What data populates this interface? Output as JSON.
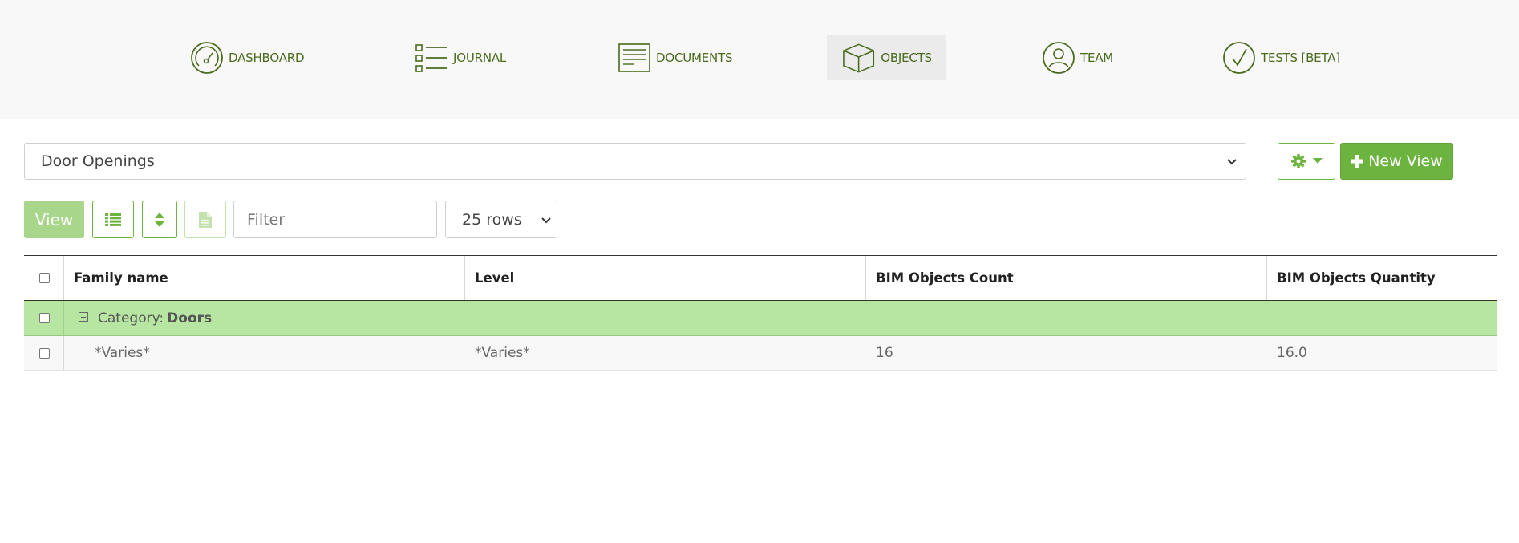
{
  "nav": {
    "items": [
      {
        "label": "DASHBOARD",
        "icon": "dashboard-gauge-icon"
      },
      {
        "label": "JOURNAL",
        "icon": "journal-list-icon"
      },
      {
        "label": "DOCUMENTS",
        "icon": "documents-icon"
      },
      {
        "label": "OBJECTS",
        "icon": "objects-cube-icon",
        "active": true
      },
      {
        "label": "TEAM",
        "icon": "team-user-icon"
      },
      {
        "label": "TESTS [BETA]",
        "icon": "tests-check-icon"
      }
    ]
  },
  "view_selector": {
    "selected": "Door Openings"
  },
  "toolbar": {
    "new_view_label": "New View",
    "view_label": "View",
    "filter_placeholder": "Filter",
    "rows_selected": "25 rows"
  },
  "table": {
    "columns": [
      "Family name",
      "Level",
      "BIM Objects Count",
      "BIM Objects Quantity"
    ],
    "group": {
      "prefix": "Category:",
      "name": "Doors"
    },
    "rows": [
      {
        "family": "*Varies*",
        "level": "*Varies*",
        "count": "16",
        "quantity": "16.0"
      }
    ]
  },
  "colors": {
    "accent": "#6db33f",
    "nav_text": "#4a6b1d",
    "group_row": "#b7e6a3"
  }
}
